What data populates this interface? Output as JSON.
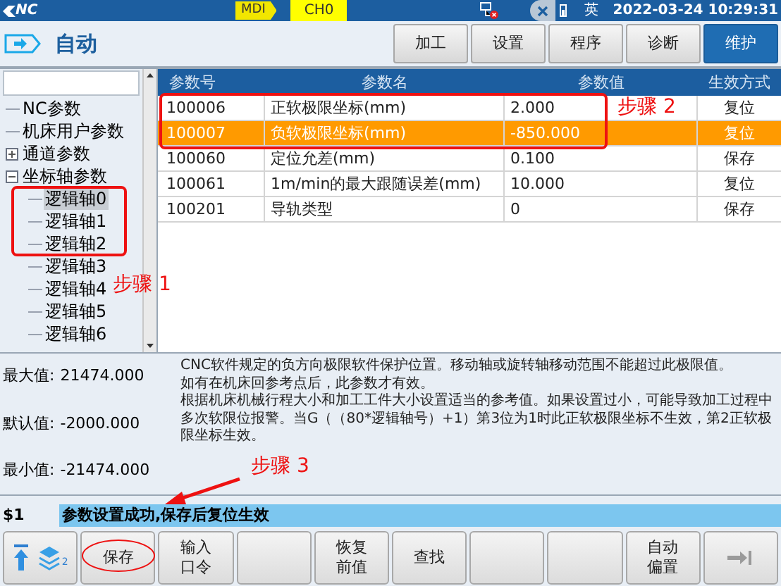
{
  "top_bar": {
    "logo_text": "NC",
    "mode_badge": "MDI",
    "channel": "CH0",
    "input_method": "英",
    "datetime": "2022-03-24 10:29:31"
  },
  "mode_bar": {
    "mode": "自动",
    "tabs": [
      {
        "label": "加工",
        "selected": false
      },
      {
        "label": "设置",
        "selected": false
      },
      {
        "label": "程序",
        "selected": false
      },
      {
        "label": "诊断",
        "selected": false
      },
      {
        "label": "维护",
        "selected": true
      }
    ]
  },
  "tree": {
    "items": [
      {
        "label": "NC参数",
        "selected": false
      },
      {
        "label": "机床用户参数",
        "selected": false
      },
      {
        "label": "通道参数",
        "selected": false,
        "expanded": false
      },
      {
        "label": "坐标轴参数",
        "selected": false,
        "expanded": true,
        "children": [
          {
            "label": "逻辑轴0",
            "selected": true
          },
          {
            "label": "逻辑轴1",
            "selected": false
          },
          {
            "label": "逻辑轴2",
            "selected": false
          },
          {
            "label": "逻辑轴3",
            "selected": false
          },
          {
            "label": "逻辑轴4",
            "selected": false
          },
          {
            "label": "逻辑轴5",
            "selected": false
          },
          {
            "label": "逻辑轴6",
            "selected": false
          }
        ]
      }
    ]
  },
  "table": {
    "columns": [
      "参数号",
      "参数名",
      "参数值",
      "生效方式"
    ],
    "rows": [
      {
        "cells": [
          "100006",
          "正软极限坐标(mm)",
          "2.000",
          "复位"
        ],
        "selected": false
      },
      {
        "cells": [
          "100007",
          "负软极限坐标(mm)",
          "-850.000",
          "复位"
        ],
        "selected": true
      },
      {
        "cells": [
          "100060",
          "定位允差(mm)",
          "0.100",
          "保存"
        ],
        "selected": false
      },
      {
        "cells": [
          "100061",
          "1m/min的最大跟随误差(mm)",
          "10.000",
          "复位"
        ],
        "selected": false
      },
      {
        "cells": [
          "100201",
          "导轨类型",
          "0",
          "保存"
        ],
        "selected": false
      }
    ]
  },
  "info": {
    "limits": [
      {
        "label": "最大值:",
        "value": "21474.000"
      },
      {
        "label": "默认值:",
        "value": "-2000.000"
      },
      {
        "label": "最小值:",
        "value": "-21474.000"
      }
    ],
    "description": [
      "CNC软件规定的负方向极限软件保护位置。移动轴或旋转轴移动范围不能超过此极限值。",
      "如有在机床回参考点后，此参数才有效。",
      "根据机床机械行程大小和加工工件大小设置适当的参考值。如果设置过小，可能导致加工过程中多次软限位报警。当G（（80*逻辑轴号）+1）第3位为1时此正软极限坐标不生效，第2正软极限坐标生效。"
    ]
  },
  "status": {
    "channel": "$1",
    "message": "参数设置成功,保存后复位生效"
  },
  "softkeys": [
    {
      "kind": "icons",
      "badge": "2"
    },
    {
      "kind": "text",
      "lines": [
        "保存"
      ]
    },
    {
      "kind": "text",
      "lines": [
        "输入",
        "口令"
      ]
    },
    {
      "kind": "empty"
    },
    {
      "kind": "text",
      "lines": [
        "恢复",
        "前值"
      ]
    },
    {
      "kind": "text",
      "lines": [
        "查找"
      ]
    },
    {
      "kind": "empty"
    },
    {
      "kind": "empty"
    },
    {
      "kind": "text",
      "lines": [
        "自动",
        "偏置"
      ]
    },
    {
      "kind": "next"
    }
  ],
  "annotations": [
    "步骤 1",
    "步骤 2",
    "步骤 3"
  ]
}
